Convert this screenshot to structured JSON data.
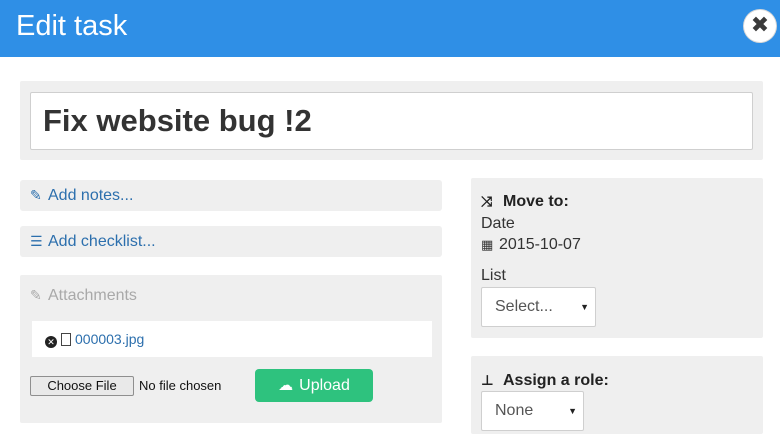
{
  "header": {
    "title": "Edit task",
    "close_glyph": "✖"
  },
  "task": {
    "title": "Fix website bug !2"
  },
  "actions": {
    "add_notes_label": "Add notes...",
    "add_checklist_label": "Add checklist..."
  },
  "attachments": {
    "heading": "Attachments",
    "files": [
      {
        "name": "000003.jpg"
      }
    ],
    "choose_file_label": "Choose File",
    "no_file_label": "No file chosen",
    "upload_label": "Upload"
  },
  "move_to": {
    "heading": "Move to:",
    "date_label": "Date",
    "date_value": "2015-10-07",
    "list_label": "List",
    "list_selected": "Select..."
  },
  "assign_role": {
    "heading": "Assign a role:",
    "selected": "None"
  },
  "colors": {
    "header_bg": "#2f8fe6",
    "link": "#2c6fad",
    "upload_bg": "#2ec27e",
    "well_bg": "#efefef"
  },
  "icons": {
    "close": "close-icon",
    "notes": "pencil-icon",
    "checklist": "list-icon",
    "attachments": "paperclip-icon",
    "remove_file": "remove-circle-icon",
    "file": "file-icon",
    "upload": "cloud-upload-icon",
    "move": "shuffle-icon",
    "date": "calendar-icon",
    "role": "sitemap-icon"
  }
}
